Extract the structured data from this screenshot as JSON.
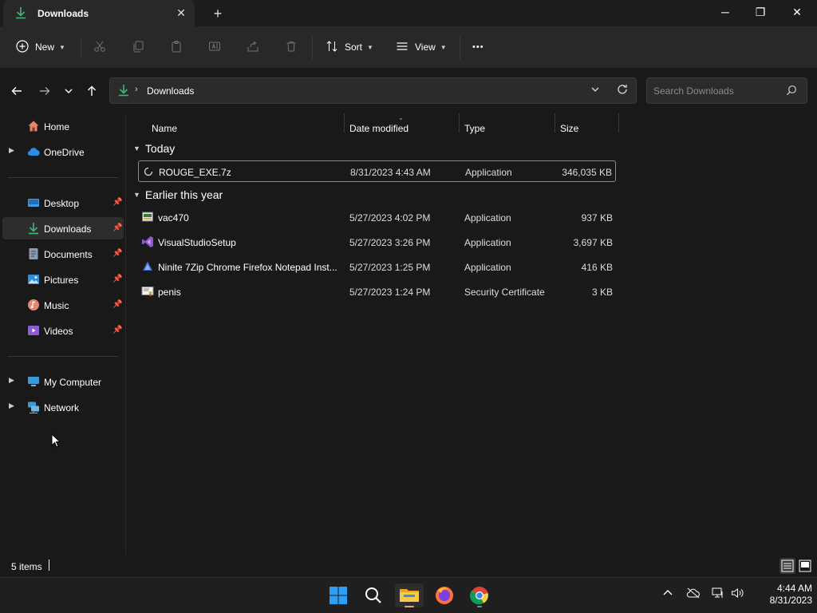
{
  "tab": {
    "title": "Downloads",
    "close": "✕",
    "new": "+"
  },
  "window_controls": {
    "minimize": "─",
    "maximize": "❐",
    "close": "✕"
  },
  "commandbar": {
    "new_label": "New",
    "sort_label": "Sort",
    "view_label": "View",
    "more_label": "•••"
  },
  "address": {
    "path": "Downloads",
    "separator": "›"
  },
  "search": {
    "placeholder": "Search Downloads"
  },
  "sidebar": {
    "items": [
      {
        "label": "Home",
        "icon": "home-icon"
      },
      {
        "label": "OneDrive",
        "icon": "cloud-icon"
      },
      {
        "label": "Desktop",
        "icon": "desktop-icon",
        "pinned": true
      },
      {
        "label": "Downloads",
        "icon": "download-icon",
        "pinned": true,
        "active": true
      },
      {
        "label": "Documents",
        "icon": "document-icon",
        "pinned": true
      },
      {
        "label": "Pictures",
        "icon": "pictures-icon",
        "pinned": true
      },
      {
        "label": "Music",
        "icon": "music-icon",
        "pinned": true
      },
      {
        "label": "Videos",
        "icon": "videos-icon",
        "pinned": true
      },
      {
        "label": "My Computer",
        "icon": "computer-icon"
      },
      {
        "label": "Network",
        "icon": "network-icon"
      }
    ]
  },
  "columns": {
    "name": "Name",
    "date": "Date modified",
    "type": "Type",
    "size": "Size"
  },
  "groups": [
    {
      "label": "Today",
      "files": [
        {
          "name": "ROUGE_EXE.7z",
          "date": "8/31/2023 4:43 AM",
          "type": "Application",
          "size": "346,035 KB"
        }
      ]
    },
    {
      "label": "Earlier this year",
      "files": [
        {
          "name": "vac470",
          "date": "5/27/2023 4:02 PM",
          "type": "Application",
          "size": "937 KB"
        },
        {
          "name": "VisualStudioSetup",
          "date": "5/27/2023 3:26 PM",
          "type": "Application",
          "size": "3,697 KB"
        },
        {
          "name": "Ninite 7Zip Chrome Firefox Notepad Inst...",
          "date": "5/27/2023 1:25 PM",
          "type": "Application",
          "size": "416 KB"
        },
        {
          "name": "penis",
          "date": "5/27/2023 1:24 PM",
          "type": "Security Certificate",
          "size": "3 KB"
        }
      ]
    }
  ],
  "status": {
    "items": "5 items"
  },
  "clock": {
    "time": "4:44 AM",
    "date": "8/31/2023"
  },
  "colors": {
    "accent": "#3fb67a",
    "folder": "#f2c14e",
    "background": "#191919"
  }
}
